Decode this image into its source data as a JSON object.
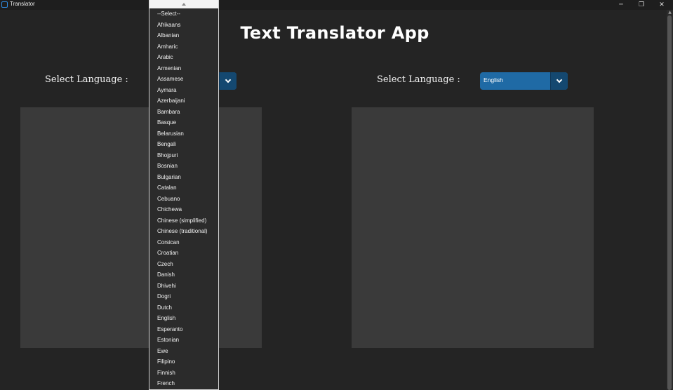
{
  "window": {
    "title": "Translator",
    "controls": {
      "minimize": "─",
      "maximize": "❐",
      "close": "✕"
    }
  },
  "app": {
    "heading": "Text Translator App"
  },
  "source": {
    "label": "Select Language :",
    "selected": ""
  },
  "target": {
    "label": "Select Language :",
    "selected": "English"
  },
  "colors": {
    "background": "#242424",
    "accent": "#1f6aa5",
    "accent_dark": "#144870",
    "textbox": "#3a3a3a"
  },
  "dropdown": {
    "options": [
      "--Select--",
      "Afrikaans",
      "Albanian",
      "Amharic",
      "Arabic",
      "Armenian",
      "Assamese",
      "Aymara",
      "Azerbaijani",
      "Bambara",
      "Basque",
      "Belarusian",
      "Bengali",
      "Bhojpuri",
      "Bosnian",
      "Bulgarian",
      "Catalan",
      "Cebuano",
      "Chichewa",
      "Chinese (simplified)",
      "Chinese (traditional)",
      "Corsican",
      "Croatian",
      "Czech",
      "Danish",
      "Dhivehi",
      "Dogri",
      "Dutch",
      "English",
      "Esperanto",
      "Estonian",
      "Ewe",
      "Filipino",
      "Finnish",
      "French"
    ]
  }
}
